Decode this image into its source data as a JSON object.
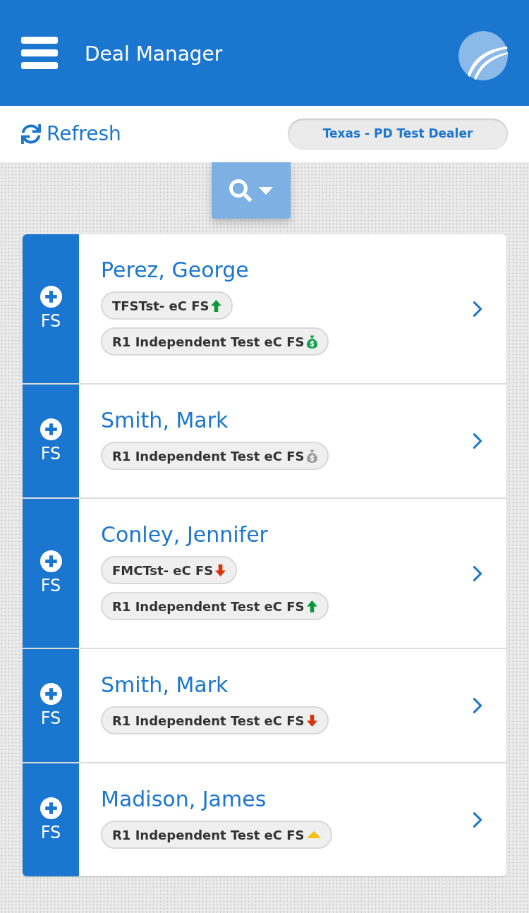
{
  "header": {
    "title": "Deal Manager"
  },
  "toolbar": {
    "refresh_label": "Refresh",
    "dealer": "Texas - PD Test Dealer"
  },
  "deals": [
    {
      "product": "FS",
      "name": "Perez, George",
      "tags": [
        {
          "label": "TFSTst- eC FS",
          "kind": "up",
          "color": "#0b9a3b"
        },
        {
          "label": "R1 Independent Test eC FS",
          "kind": "money",
          "color": "#14a04c"
        }
      ]
    },
    {
      "product": "FS",
      "name": "Smith, Mark",
      "tags": [
        {
          "label": "R1 Independent Test eC FS",
          "kind": "money",
          "color": "#9e9e9e"
        }
      ]
    },
    {
      "product": "FS",
      "name": "Conley, Jennifer",
      "tags": [
        {
          "label": "FMCTst- eC FS",
          "kind": "down",
          "color": "#d9350c"
        },
        {
          "label": "R1 Independent Test eC FS",
          "kind": "up",
          "color": "#0b9a3b"
        }
      ]
    },
    {
      "product": "FS",
      "name": "Smith, Mark",
      "tags": [
        {
          "label": "R1 Independent Test eC FS",
          "kind": "down",
          "color": "#d9350c"
        }
      ]
    },
    {
      "product": "FS",
      "name": "Madison, James",
      "tags": [
        {
          "label": "R1 Independent Test eC FS",
          "kind": "pending",
          "color": "#f5bf14"
        }
      ]
    }
  ]
}
